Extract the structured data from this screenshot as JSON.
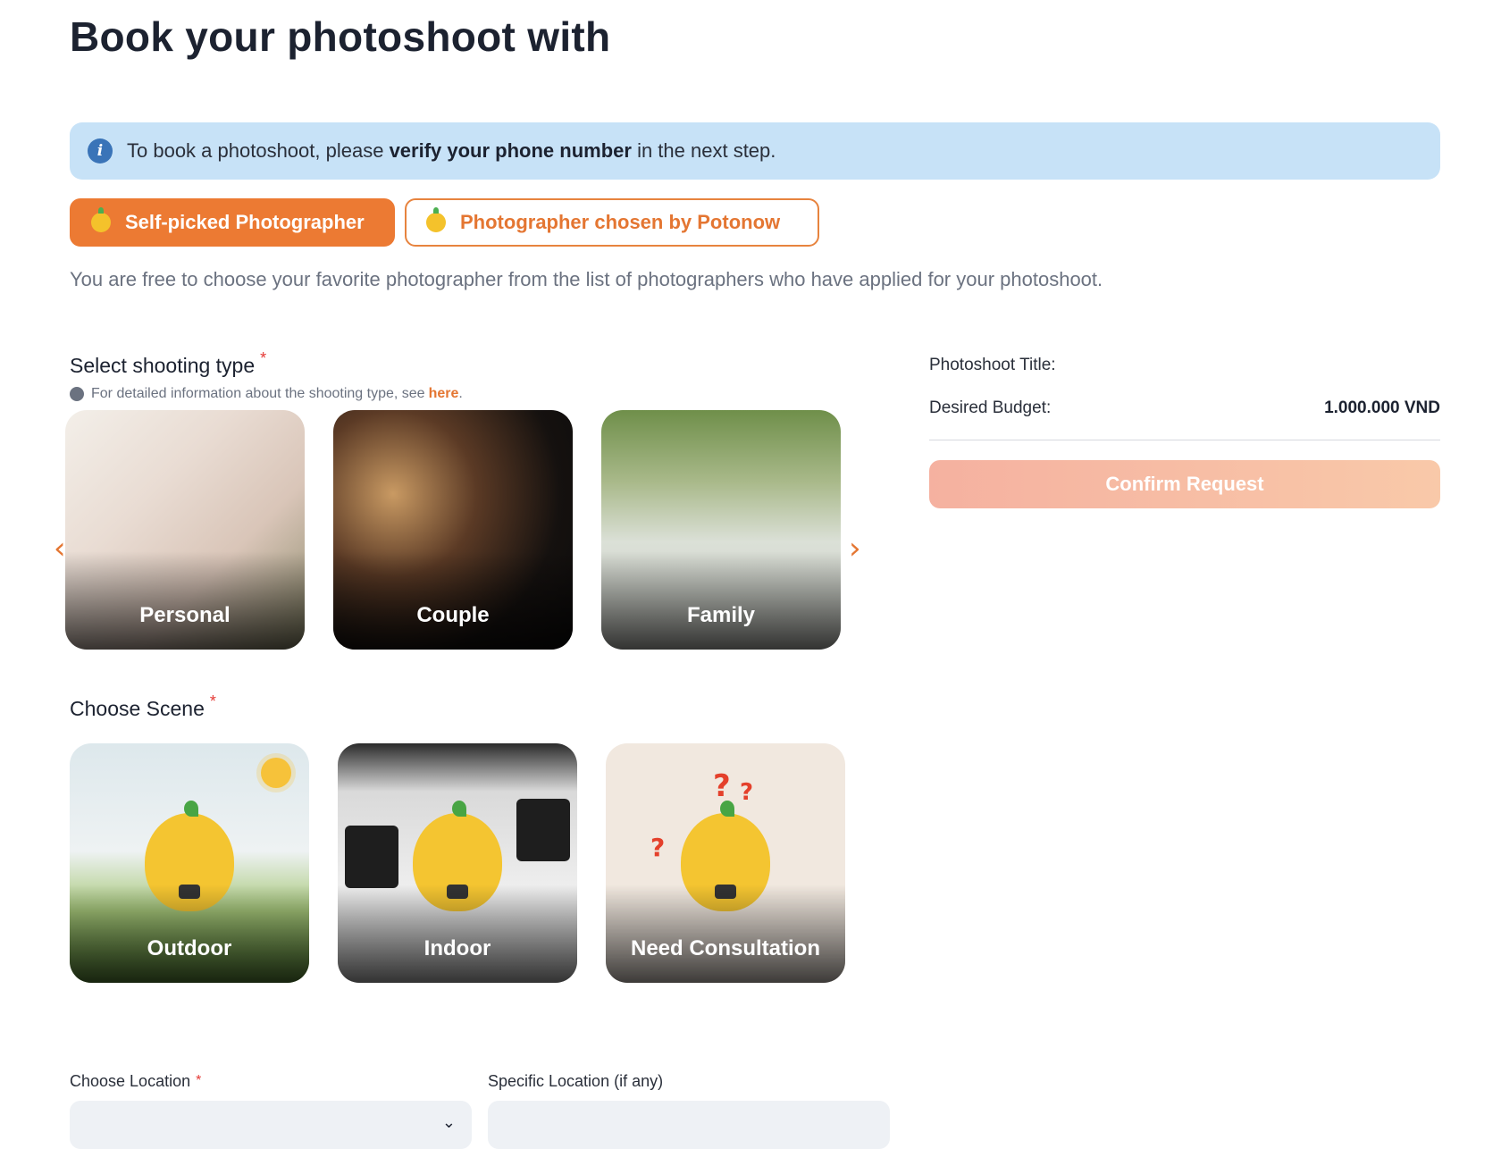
{
  "header": {
    "title": "Book your photoshoot with"
  },
  "info_banner": {
    "prefix": "To book a photoshoot, please ",
    "bold": "verify your phone number",
    "suffix": " in the next step."
  },
  "modes": {
    "self_picked": "Self-picked Photographer",
    "chosen_by": "Photographer chosen by Potonow",
    "description": "You are free to choose your favorite photographer from the list of photographers who have applied for your photoshoot."
  },
  "shooting_type": {
    "label": "Select shooting type",
    "required_mark": "*",
    "hint_text": "For detailed information about the shooting type, see",
    "hint_link": "here",
    "hint_period": ".",
    "items": [
      "Personal",
      "Couple",
      "Family"
    ]
  },
  "scene": {
    "label": "Choose Scene",
    "required_mark": "*",
    "items": [
      "Outdoor",
      "Indoor",
      "Need Consultation"
    ]
  },
  "location": {
    "label": "Choose Location",
    "required_mark": "*",
    "value": "",
    "specific_label": "Specific Location (if any)",
    "specific_value": ""
  },
  "summary": {
    "title_label": "Photoshoot Title:",
    "title_value": "",
    "budget_label": "Desired Budget:",
    "budget_value": "1.000.000 VND",
    "confirm_label": "Confirm Request"
  },
  "colors": {
    "accent": "#ec7a33",
    "info_bg": "#c7e2f7",
    "required": "#e53935"
  },
  "icons": {
    "info": "info-icon",
    "prev": "chevron-left-icon",
    "next": "chevron-right-icon",
    "select": "chevron-down-icon"
  }
}
